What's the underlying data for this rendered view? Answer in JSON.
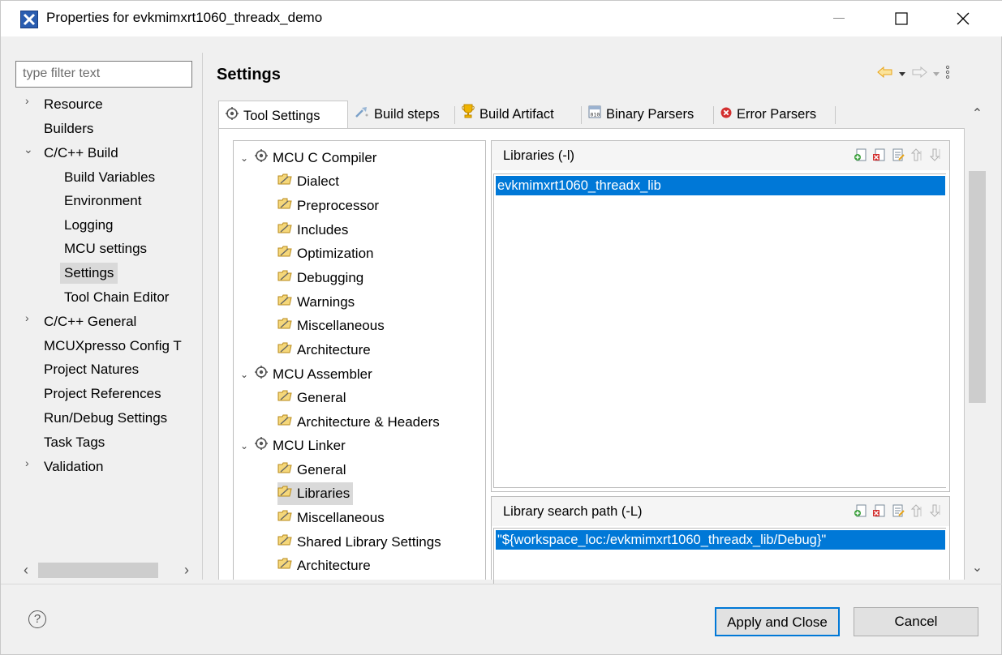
{
  "window": {
    "title": "Properties for evkmimxrt1060_threadx_demo"
  },
  "filter": {
    "placeholder": "type filter text"
  },
  "nav": {
    "items": [
      {
        "label": "Resource"
      },
      {
        "label": "Builders"
      },
      {
        "label": "C/C++ Build"
      },
      {
        "label": "Build Variables"
      },
      {
        "label": "Environment"
      },
      {
        "label": "Logging"
      },
      {
        "label": "MCU settings"
      },
      {
        "label": "Settings"
      },
      {
        "label": "Tool Chain Editor"
      },
      {
        "label": "C/C++ General"
      },
      {
        "label": "MCUXpresso Config T"
      },
      {
        "label": "Project Natures"
      },
      {
        "label": "Project References"
      },
      {
        "label": "Run/Debug Settings"
      },
      {
        "label": "Task Tags"
      },
      {
        "label": "Validation"
      }
    ]
  },
  "page": {
    "title": "Settings"
  },
  "tabs": [
    {
      "label": "Tool Settings",
      "icon": "tool-settings-icon"
    },
    {
      "label": "Build steps",
      "icon": "build-steps-icon"
    },
    {
      "label": "Build Artifact",
      "icon": "trophy-icon"
    },
    {
      "label": "Binary Parsers",
      "icon": "binary-parser-icon"
    },
    {
      "label": "Error Parsers",
      "icon": "error-icon"
    }
  ],
  "tree": {
    "items": [
      {
        "label": "MCU C Compiler"
      },
      {
        "label": "Dialect"
      },
      {
        "label": "Preprocessor"
      },
      {
        "label": "Includes"
      },
      {
        "label": "Optimization"
      },
      {
        "label": "Debugging"
      },
      {
        "label": "Warnings"
      },
      {
        "label": "Miscellaneous"
      },
      {
        "label": "Architecture"
      },
      {
        "label": "MCU Assembler"
      },
      {
        "label": "General"
      },
      {
        "label": "Architecture & Headers"
      },
      {
        "label": "MCU Linker"
      },
      {
        "label": "General"
      },
      {
        "label": "Libraries"
      },
      {
        "label": "Miscellaneous"
      },
      {
        "label": "Shared Library Settings"
      },
      {
        "label": "Architecture"
      }
    ]
  },
  "libraries": {
    "label": "Libraries (-l)",
    "entries": [
      "evkmimxrt1060_threadx_lib"
    ]
  },
  "search_path": {
    "label": "Library search path (-L)",
    "entries": [
      "\"${workspace_loc:/evkmimxrt1060_threadx_lib/Debug}\""
    ]
  },
  "footer": {
    "help": "?",
    "apply_label": "Apply and Close",
    "cancel_label": "Cancel"
  },
  "colors": {
    "selection": "#0078d7",
    "accent_arrow": "#e8a317",
    "error": "#d32f2f"
  }
}
